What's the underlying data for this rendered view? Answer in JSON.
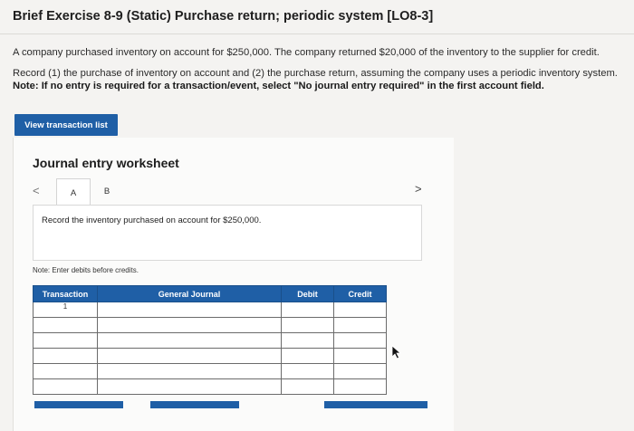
{
  "header": {
    "title": "Brief Exercise 8-9 (Static) Purchase return; periodic system [LO8-3]"
  },
  "problem": {
    "paragraph1": "A company purchased inventory on account for $250,000. The company returned $20,000 of the inventory to the supplier for credit.",
    "paragraph2": "Record (1) the purchase of inventory on account and (2) the purchase return, assuming the company uses a periodic inventory system.",
    "note": "Note: If no entry is required for a transaction/event, select \"No journal entry required\" in the first account field."
  },
  "buttons": {
    "view_transaction_list": "View transaction list"
  },
  "worksheet": {
    "title": "Journal entry worksheet",
    "tabs": [
      "A",
      "B"
    ],
    "prev_icon": "<",
    "next_icon": ">",
    "instruction": "Record the inventory purchased on account for $250,000.",
    "note": "Note: Enter debits before credits."
  },
  "table": {
    "headers": [
      "Transaction",
      "General Journal",
      "Debit",
      "Credit"
    ],
    "rows": [
      [
        "1",
        "",
        "",
        ""
      ],
      [
        "",
        "",
        "",
        ""
      ],
      [
        "",
        "",
        "",
        ""
      ],
      [
        "",
        "",
        "",
        ""
      ],
      [
        "",
        "",
        "",
        ""
      ],
      [
        "",
        "",
        "",
        ""
      ]
    ]
  },
  "colors": {
    "primary": "#1f5fa6",
    "background": "#f4f3f1"
  }
}
